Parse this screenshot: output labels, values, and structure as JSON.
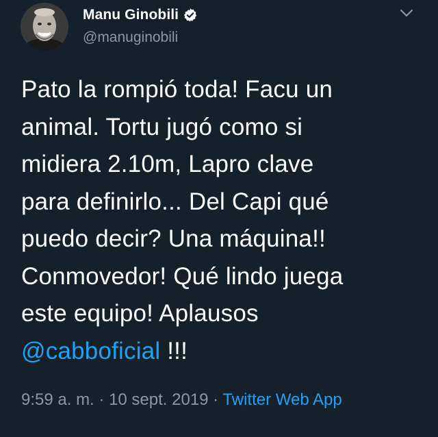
{
  "author": {
    "display_name": "Manu Ginobili",
    "handle": "@manuginobili",
    "verified": true,
    "avatar_icon": "avatar-photo"
  },
  "tweet": {
    "lines": [
      "Pato la rompió toda! Facu un",
      "animal. Tortu jugó como si",
      "midiera 2.10m, Lapro clave",
      "para definirlo... Del Capi qué",
      "puedo decir? Una máquina!!",
      "Conmovedor! Qué lindo juega",
      "este equipo! Aplausos"
    ],
    "mention": "@cabboficial",
    "trailing_text": " !!!"
  },
  "meta": {
    "time": "9:59 a. m.",
    "separator1": " · ",
    "date": "10 sept. 2019",
    "separator2": " · ",
    "source": "Twitter Web App"
  },
  "colors": {
    "background": "#15202b",
    "text": "#ffffff",
    "secondary": "#8899a6",
    "accent": "#1da1f2"
  },
  "icons": {
    "verified": "verified-badge-icon",
    "more": "chevron-down-icon"
  }
}
